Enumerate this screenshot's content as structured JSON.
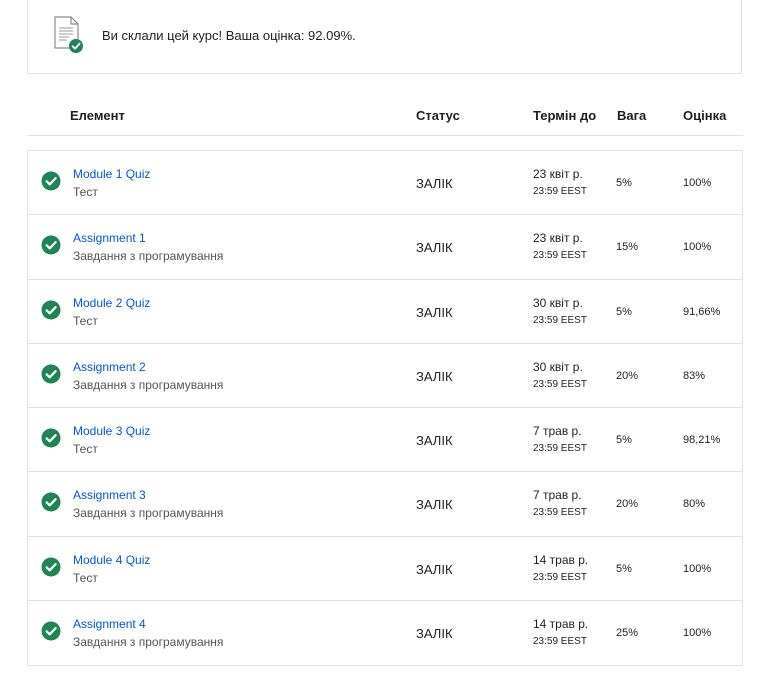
{
  "banner": {
    "icon": "document-check-icon",
    "text": "Ви склали цей курс! Ваша оцінка: 92.09%."
  },
  "columns": {
    "item": "Елемент",
    "status": "Статус",
    "due": "Термін до",
    "weight": "Вага",
    "grade": "Оцінка"
  },
  "colors": {
    "check": "#1f8354",
    "link": "#0056d2",
    "border": "#e1e1e1"
  },
  "rows": [
    {
      "name": "Module 1 Quiz",
      "type": "Тест",
      "status": "ЗАЛІК",
      "due_date": "23 квіт р.",
      "due_time": "23:59 EEST",
      "weight": "5%",
      "grade": "100%"
    },
    {
      "name": "Assignment 1",
      "type": "Завдання з програмування",
      "status": "ЗАЛІК",
      "due_date": "23 квіт р.",
      "due_time": "23:59 EEST",
      "weight": "15%",
      "grade": "100%"
    },
    {
      "name": "Module 2 Quiz",
      "type": "Тест",
      "status": "ЗАЛІК",
      "due_date": "30 квіт р.",
      "due_time": "23:59 EEST",
      "weight": "5%",
      "grade": "91,66%"
    },
    {
      "name": "Assignment 2",
      "type": "Завдання з програмування",
      "status": "ЗАЛІК",
      "due_date": "30 квіт р.",
      "due_time": "23:59 EEST",
      "weight": "20%",
      "grade": "83%"
    },
    {
      "name": "Module 3 Quiz",
      "type": "Тест",
      "status": "ЗАЛІК",
      "due_date": "7 трав р.",
      "due_time": "23:59 EEST",
      "weight": "5%",
      "grade": "98,21%"
    },
    {
      "name": "Assignment 3",
      "type": "Завдання з програмування",
      "status": "ЗАЛІК",
      "due_date": "7 трав р.",
      "due_time": "23:59 EEST",
      "weight": "20%",
      "grade": "80%"
    },
    {
      "name": "Module 4 Quiz",
      "type": "Тест",
      "status": "ЗАЛІК",
      "due_date": "14 трав р.",
      "due_time": "23:59 EEST",
      "weight": "5%",
      "grade": "100%"
    },
    {
      "name": "Assignment 4",
      "type": "Завдання з програмування",
      "status": "ЗАЛІК",
      "due_date": "14 трав р.",
      "due_time": "23:59 EEST",
      "weight": "25%",
      "grade": "100%"
    }
  ]
}
